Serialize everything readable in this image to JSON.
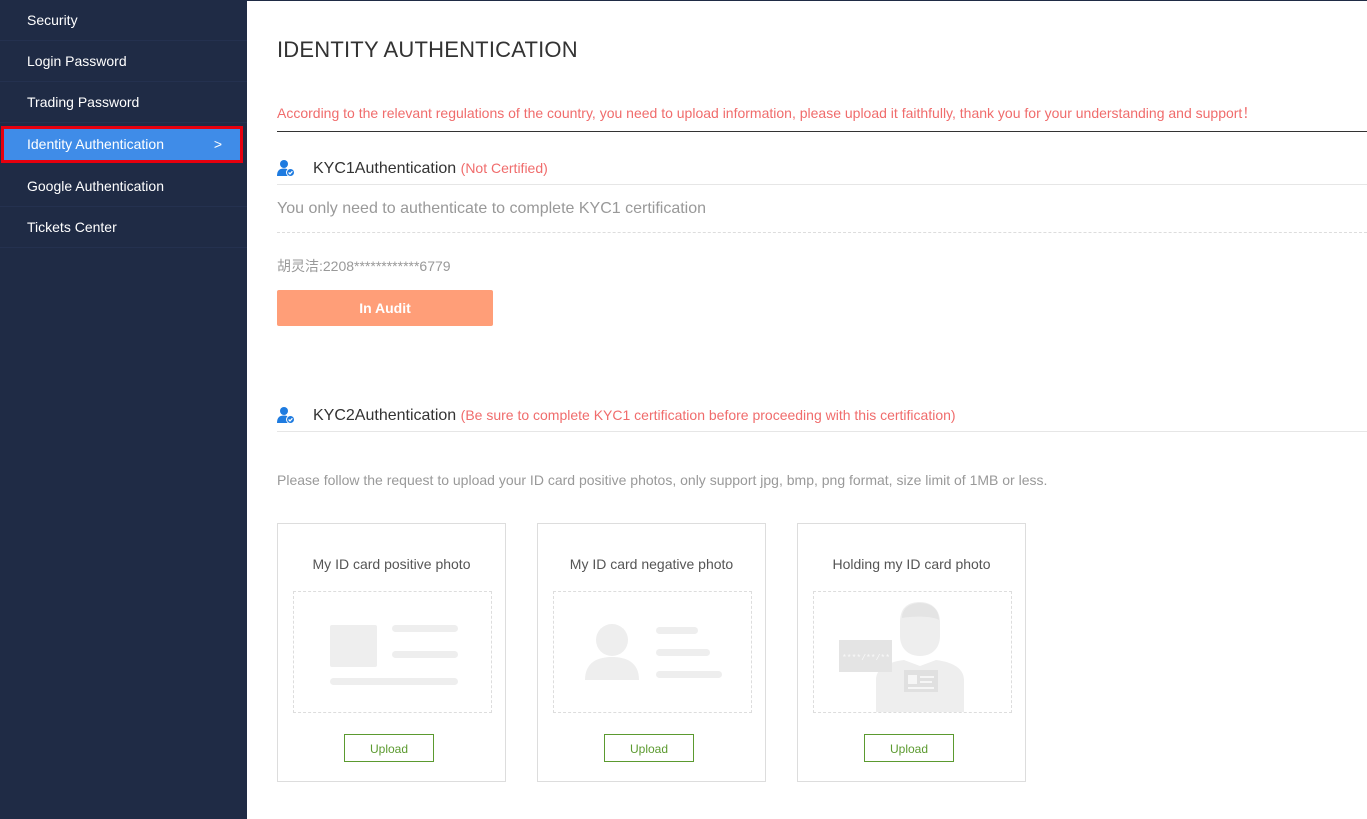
{
  "sidebar": {
    "items": [
      {
        "label": "Security"
      },
      {
        "label": "Login Password"
      },
      {
        "label": "Trading Password"
      },
      {
        "label": "Identity Authentication",
        "active": true
      },
      {
        "label": "Google Authentication"
      },
      {
        "label": "Tickets Center"
      }
    ],
    "active_chevron": ">"
  },
  "main": {
    "title": "IDENTITY AUTHENTICATION",
    "notice": "According to the relevant regulations of the country, you need to upload information, please upload it faithfully, thank you for your understanding and support！",
    "kyc1": {
      "title": "KYC1Authentication",
      "status": "(Not Certified)",
      "description": "You only need to authenticate to complete KYC1 certification",
      "id_info": "胡灵洁:2208************6779",
      "button_label": "In Audit"
    },
    "kyc2": {
      "title": "KYC2Authentication",
      "status": "(Be sure to complete KYC1 certification before proceeding with this certification)",
      "description": "Please follow the request to upload your ID card positive photos, only support jpg, bmp, png format, size limit of 1MB or less.",
      "cards": [
        {
          "title": "My ID card positive photo",
          "button": "Upload"
        },
        {
          "title": "My ID card negative photo",
          "button": "Upload"
        },
        {
          "title": "Holding my ID card photo",
          "button": "Upload",
          "card_text": "****/**/**"
        }
      ]
    }
  },
  "colors": {
    "sidebar_bg": "#1f2b45",
    "active_bg": "#3f8ce8",
    "highlight_border": "#e6000e",
    "warning_text": "#f06c6c",
    "audit_button": "#ff9e78",
    "upload_green": "#5b9a2f",
    "icon_blue": "#1e7be0"
  }
}
